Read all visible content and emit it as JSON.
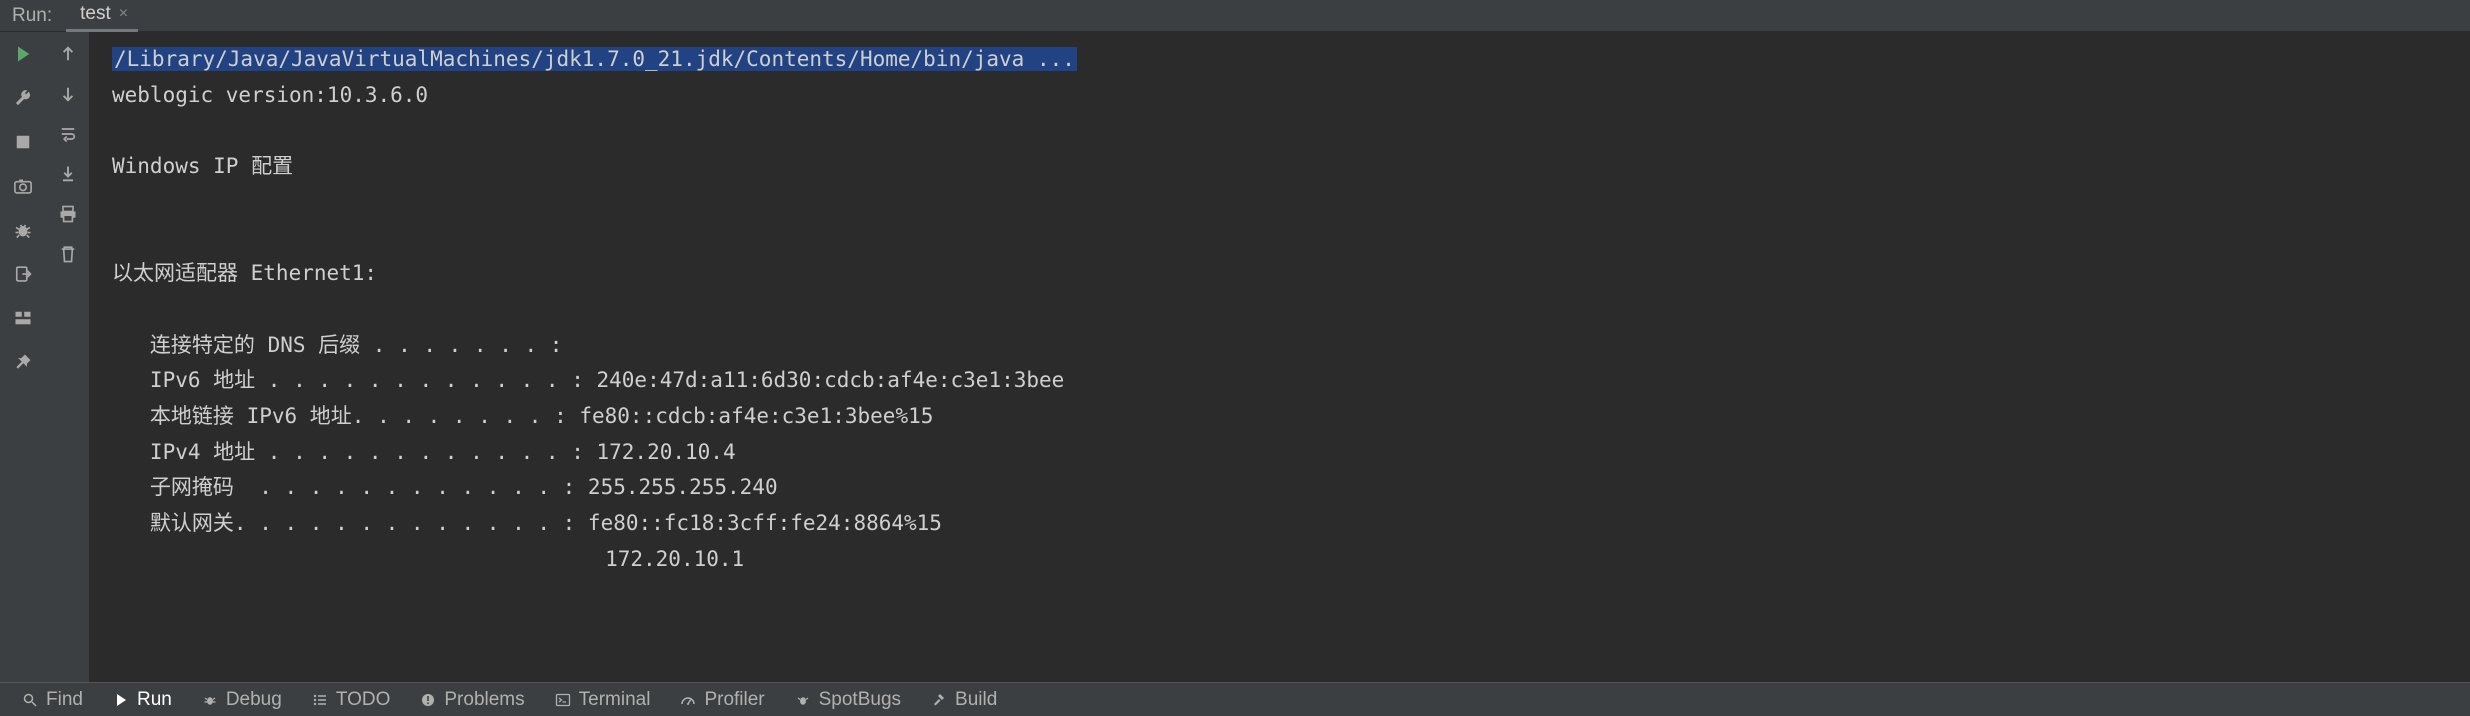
{
  "tabbar": {
    "label": "Run:",
    "tab_name": "test"
  },
  "console": {
    "command": "/Library/Java/JavaVirtualMachines/jdk1.7.0_21.jdk/Contents/Home/bin/java ...",
    "lines": [
      "weblogic version:10.3.6.0",
      "",
      "Windows IP 配置",
      "",
      "",
      "以太网适配器 Ethernet1:",
      "",
      "   连接特定的 DNS 后缀 . . . . . . . :",
      "   IPv6 地址 . . . . . . . . . . . . : 240e:47d:a11:6d30:cdcb:af4e:c3e1:3bee",
      "   本地链接 IPv6 地址. . . . . . . . : fe80::cdcb:af4e:c3e1:3bee%15",
      "   IPv4 地址 . . . . . . . . . . . . : 172.20.10.4",
      "   子网掩码  . . . . . . . . . . . . : 255.255.255.240",
      "   默认网关. . . . . . . . . . . . . : fe80::fc18:3cff:fe24:8864%15",
      "                                       172.20.10.1"
    ]
  },
  "bottom": {
    "find": "Find",
    "run": "Run",
    "debug": "Debug",
    "todo": "TODO",
    "problems": "Problems",
    "terminal": "Terminal",
    "profiler": "Profiler",
    "spotbugs": "SpotBugs",
    "build": "Build"
  }
}
